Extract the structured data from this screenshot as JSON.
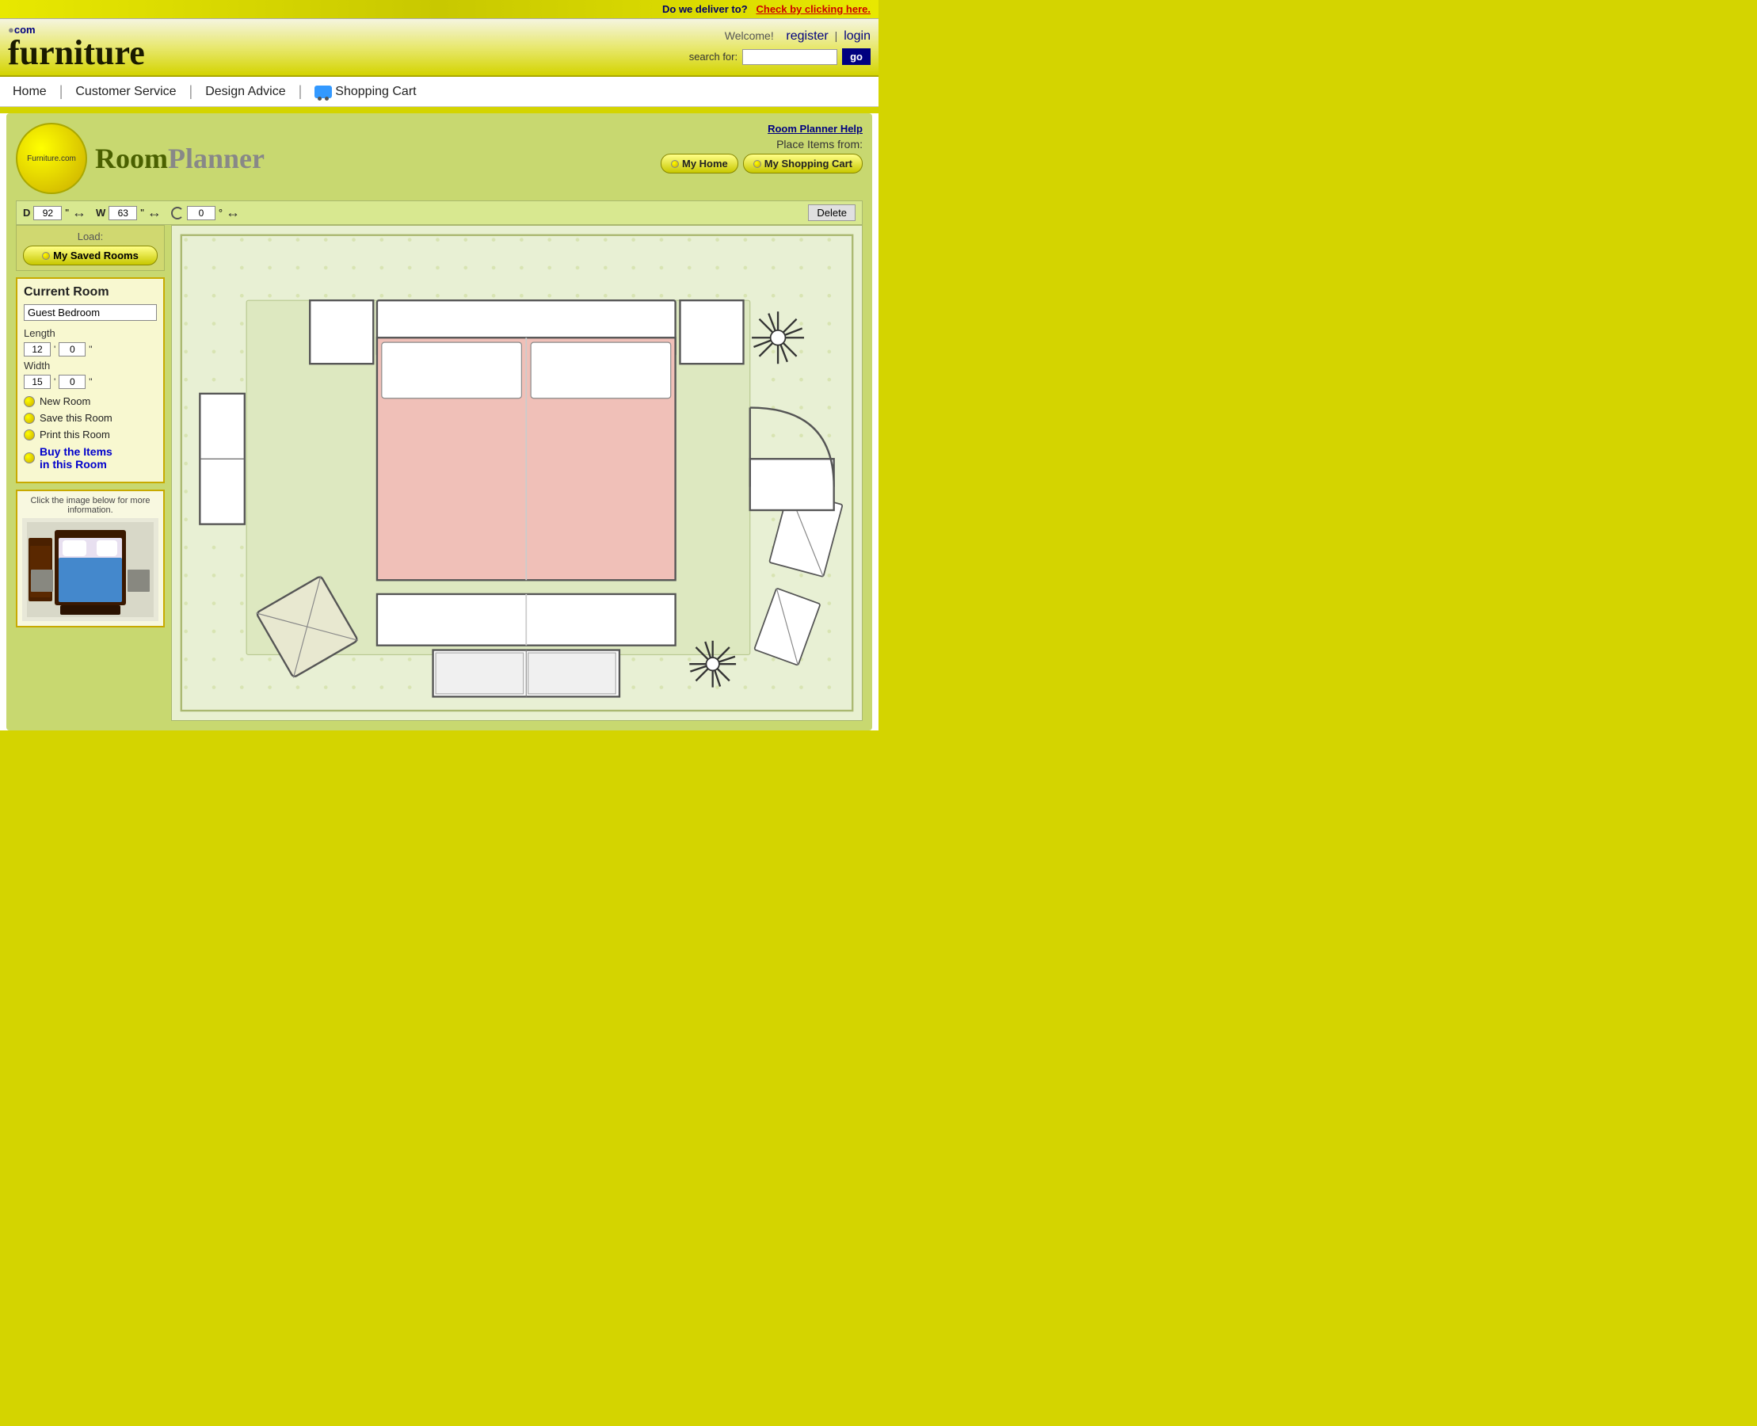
{
  "delivery": {
    "label": "Do we deliver to?",
    "link": "Check by clicking here."
  },
  "header": {
    "logo_com": ".com",
    "logo_main": "furniture",
    "welcome": "Welcome!",
    "register": "register",
    "login": "login",
    "search_label": "search for:",
    "search_placeholder": "",
    "go_label": "go"
  },
  "nav": {
    "items": [
      {
        "label": "Home",
        "id": "home"
      },
      {
        "label": "Customer Service",
        "id": "customer-service"
      },
      {
        "label": "Design Advice",
        "id": "design-advice"
      },
      {
        "label": "Shopping Cart",
        "id": "shopping-cart"
      }
    ]
  },
  "room_planner": {
    "help_link": "Room Planner Help",
    "logo_small": "Furniture.com",
    "logo_room": "Room",
    "logo_planner": "Planner",
    "place_label": "Place Items from:",
    "place_buttons": [
      {
        "label": "My Home",
        "id": "my-home"
      },
      {
        "label": "My Shopping Cart",
        "id": "my-shopping-cart"
      }
    ],
    "toolbar": {
      "d_label": "D",
      "d_value": "92",
      "d_unit": "\"",
      "w_label": "W",
      "w_value": "63",
      "w_unit": "\"",
      "rotate_value": "0",
      "rotate_unit": "°",
      "delete_label": "Delete"
    },
    "load_label": "Load:",
    "load_btn": "My Saved Rooms",
    "current_room": {
      "title": "Current Room",
      "name_value": "Guest Bedroom",
      "length_label": "Length",
      "length_ft": "12",
      "length_in": "0",
      "width_label": "Width",
      "width_ft": "15",
      "width_in": "0",
      "actions": [
        {
          "label": "New Room",
          "id": "new-room"
        },
        {
          "label": "Save this Room",
          "id": "save-room"
        },
        {
          "label": "Print this Room",
          "id": "print-room"
        },
        {
          "label": "Buy the Items in this Room",
          "id": "buy-items",
          "style": "buy"
        }
      ]
    },
    "info_box": {
      "label": "Click the image below for more information."
    }
  }
}
